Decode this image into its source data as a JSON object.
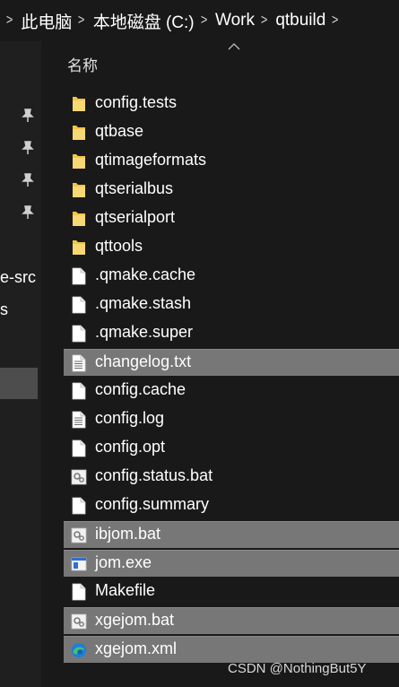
{
  "breadcrumb": [
    "此电脑",
    "本地磁盘 (C:)",
    "Work",
    "qtbuild"
  ],
  "sidebar": {
    "text_1": "e-src",
    "text_2": "s"
  },
  "header": {
    "name_column": "名称"
  },
  "files": [
    {
      "name": "config.tests",
      "icon": "folder-icon",
      "selected": false
    },
    {
      "name": "qtbase",
      "icon": "folder-icon",
      "selected": false
    },
    {
      "name": "qtimageformats",
      "icon": "folder-icon",
      "selected": false
    },
    {
      "name": "qtserialbus",
      "icon": "folder-icon",
      "selected": false
    },
    {
      "name": "qtserialport",
      "icon": "folder-icon",
      "selected": false
    },
    {
      "name": "qttools",
      "icon": "folder-icon",
      "selected": false
    },
    {
      "name": ".qmake.cache",
      "icon": "file-icon",
      "selected": false
    },
    {
      "name": ".qmake.stash",
      "icon": "file-icon",
      "selected": false
    },
    {
      "name": ".qmake.super",
      "icon": "file-icon",
      "selected": false
    },
    {
      "name": "changelog.txt",
      "icon": "text-file-icon",
      "selected": true
    },
    {
      "name": "config.cache",
      "icon": "file-icon",
      "selected": false
    },
    {
      "name": "config.log",
      "icon": "text-file-icon",
      "selected": false
    },
    {
      "name": "config.opt",
      "icon": "file-icon",
      "selected": false
    },
    {
      "name": "config.status.bat",
      "icon": "batch-file-icon",
      "selected": false
    },
    {
      "name": "config.summary",
      "icon": "file-icon",
      "selected": false
    },
    {
      "name": "ibjom.bat",
      "icon": "batch-file-icon",
      "selected": true
    },
    {
      "name": "jom.exe",
      "icon": "exe-file-icon",
      "selected": true
    },
    {
      "name": "Makefile",
      "icon": "file-icon",
      "selected": false
    },
    {
      "name": "xgejom.bat",
      "icon": "batch-file-icon",
      "selected": true
    },
    {
      "name": "xgejom.xml",
      "icon": "edge-icon",
      "selected": true
    }
  ],
  "watermark": "CSDN @NothingBut5Y",
  "colors": {
    "background": "#191919",
    "selection": "#777777",
    "folder": "#f3c542",
    "edge_blue": "#1d7fd8",
    "edge_green": "#41c372"
  }
}
